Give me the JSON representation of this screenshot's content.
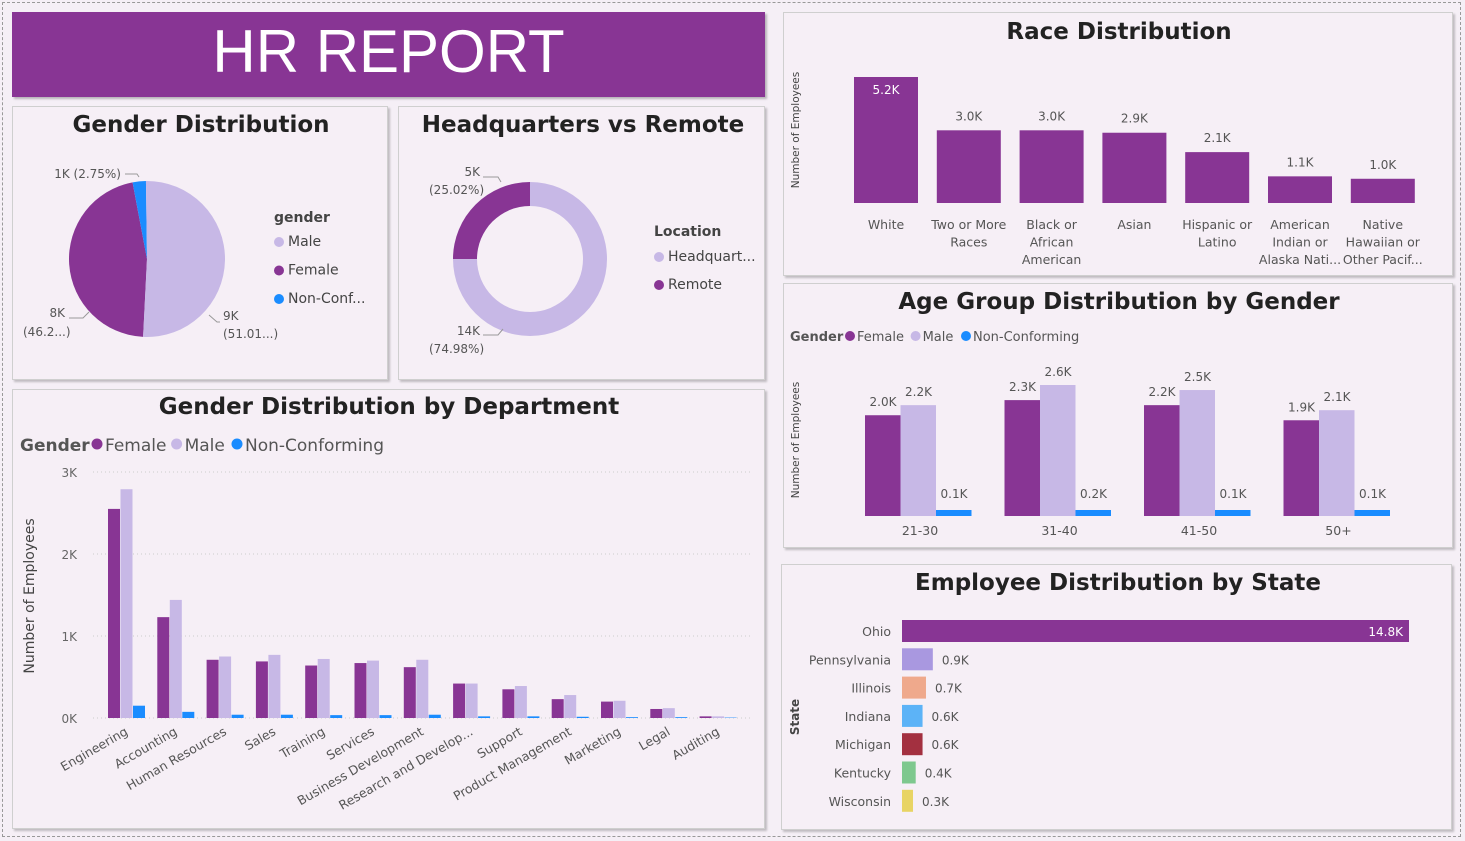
{
  "report": {
    "title": "HR REPORT"
  },
  "colors": {
    "female": "#883594",
    "male": "#c7b8e6",
    "nonconforming": "#1a8cff",
    "banner": "#883594"
  },
  "gender_panel": {
    "title": "Gender Distribution",
    "legend_title": "gender",
    "labels": {
      "nc_value": "1K (2.75%)",
      "female_value": "8K",
      "female_pct": "(46.2...)",
      "male_value": "9K",
      "male_pct": "(51.01...)"
    }
  },
  "hq_panel": {
    "title": "Headquarters vs Remote",
    "legend_title": "Location",
    "labels": {
      "remote_value": "5K",
      "remote_pct": "(25.02%)",
      "hq_value": "14K",
      "hq_pct": "(74.98%)"
    }
  },
  "dept_panel": {
    "title": "Gender Distribution by Department",
    "legend_title": "Gender"
  },
  "race_panel": {
    "title": "Race Distribution"
  },
  "age_panel": {
    "title": "Age Group Distribution by Gender",
    "legend_title": "Gender"
  },
  "state_panel": {
    "title": "Employee Distribution by State"
  },
  "chart_data": [
    {
      "id": "gender",
      "type": "pie",
      "title": "Gender Distribution",
      "legend_title": "gender",
      "legend_labels": [
        "Male",
        "Female",
        "Non-Conf..."
      ],
      "categories": [
        "Male",
        "Female",
        "Non-Conforming"
      ],
      "values": [
        51.01,
        46.24,
        2.75
      ],
      "colors": [
        "#c7b8e6",
        "#883594",
        "#1a8cff"
      ]
    },
    {
      "id": "hq",
      "type": "pie",
      "title": "Headquarters vs Remote",
      "legend_title": "Location",
      "legend_labels": [
        "Headquart...",
        "Remote"
      ],
      "categories": [
        "Headquarters",
        "Remote"
      ],
      "values": [
        74.98,
        25.02
      ],
      "colors": [
        "#c7b8e6",
        "#883594"
      ]
    },
    {
      "id": "dept",
      "type": "bar",
      "title": "Gender Distribution by Department",
      "legend_title": "Gender",
      "ylabel": "Number of Employees",
      "ylim": [
        0,
        3000
      ],
      "y_ticks": [
        "0K",
        "1K",
        "2K",
        "3K"
      ],
      "categories": [
        "Engineering",
        "Accounting",
        "Human Resources",
        "Sales",
        "Training",
        "Services",
        "Business Development",
        "Research and Develop...",
        "Support",
        "Product Management",
        "Marketing",
        "Legal",
        "Auditing"
      ],
      "series": [
        {
          "name": "Female",
          "values": [
            2550,
            1230,
            710,
            690,
            640,
            670,
            620,
            420,
            350,
            230,
            200,
            110,
            20
          ]
        },
        {
          "name": "Male",
          "values": [
            2790,
            1440,
            750,
            770,
            720,
            700,
            710,
            420,
            390,
            280,
            210,
            120,
            20
          ]
        },
        {
          "name": "Non-Conforming",
          "values": [
            150,
            75,
            40,
            40,
            35,
            35,
            40,
            20,
            20,
            15,
            10,
            10,
            5
          ]
        }
      ]
    },
    {
      "id": "race",
      "type": "bar",
      "title": "Race Distribution",
      "ylabel": "Number of Employees",
      "categories": [
        [
          "White"
        ],
        [
          "Two or More",
          "Races"
        ],
        [
          "Black or",
          "African",
          "American"
        ],
        [
          "Asian"
        ],
        [
          "Hispanic or",
          "Latino"
        ],
        [
          "American",
          "Indian or",
          "Alaska Nati..."
        ],
        [
          "Native",
          "Hawaiian or",
          "Other Pacif..."
        ]
      ],
      "values": [
        5200,
        3000,
        3000,
        2900,
        2100,
        1100,
        1000
      ],
      "data_labels": [
        "5.2K",
        "3.0K",
        "3.0K",
        "2.9K",
        "2.1K",
        "1.1K",
        "1.0K"
      ]
    },
    {
      "id": "age",
      "type": "bar",
      "title": "Age Group Distribution by Gender",
      "legend_title": "Gender",
      "ylabel": "Number of Employees",
      "categories": [
        "21-30",
        "31-40",
        "41-50",
        "50+"
      ],
      "series": [
        {
          "name": "Female",
          "values": [
            2000,
            2300,
            2200,
            1900
          ],
          "labels": [
            "2.0K",
            "2.3K",
            "2.2K",
            "1.9K"
          ]
        },
        {
          "name": "Male",
          "values": [
            2200,
            2600,
            2500,
            2100
          ],
          "labels": [
            "2.2K",
            "2.6K",
            "2.5K",
            "2.1K"
          ]
        },
        {
          "name": "Non-Conforming",
          "values": [
            100,
            150,
            120,
            110
          ],
          "labels": [
            "0.1K",
            "0.2K",
            "0.1K",
            "0.1K"
          ]
        }
      ]
    },
    {
      "id": "state",
      "type": "bar",
      "orientation": "horizontal",
      "title": "Employee Distribution by State",
      "ylabel": "State",
      "categories": [
        "Ohio",
        "Pennsylvania",
        "Illinois",
        "Indiana",
        "Michigan",
        "Kentucky",
        "Wisconsin"
      ],
      "values": [
        14800,
        900,
        700,
        600,
        600,
        400,
        300
      ],
      "data_labels": [
        "14.8K",
        "0.9K",
        "0.7K",
        "0.6K",
        "0.6K",
        "0.4K",
        "0.3K"
      ],
      "colors": [
        "#883594",
        "#a998e0",
        "#efa98c",
        "#5cb3f7",
        "#a33040",
        "#7ec88e",
        "#e8d464"
      ]
    }
  ]
}
